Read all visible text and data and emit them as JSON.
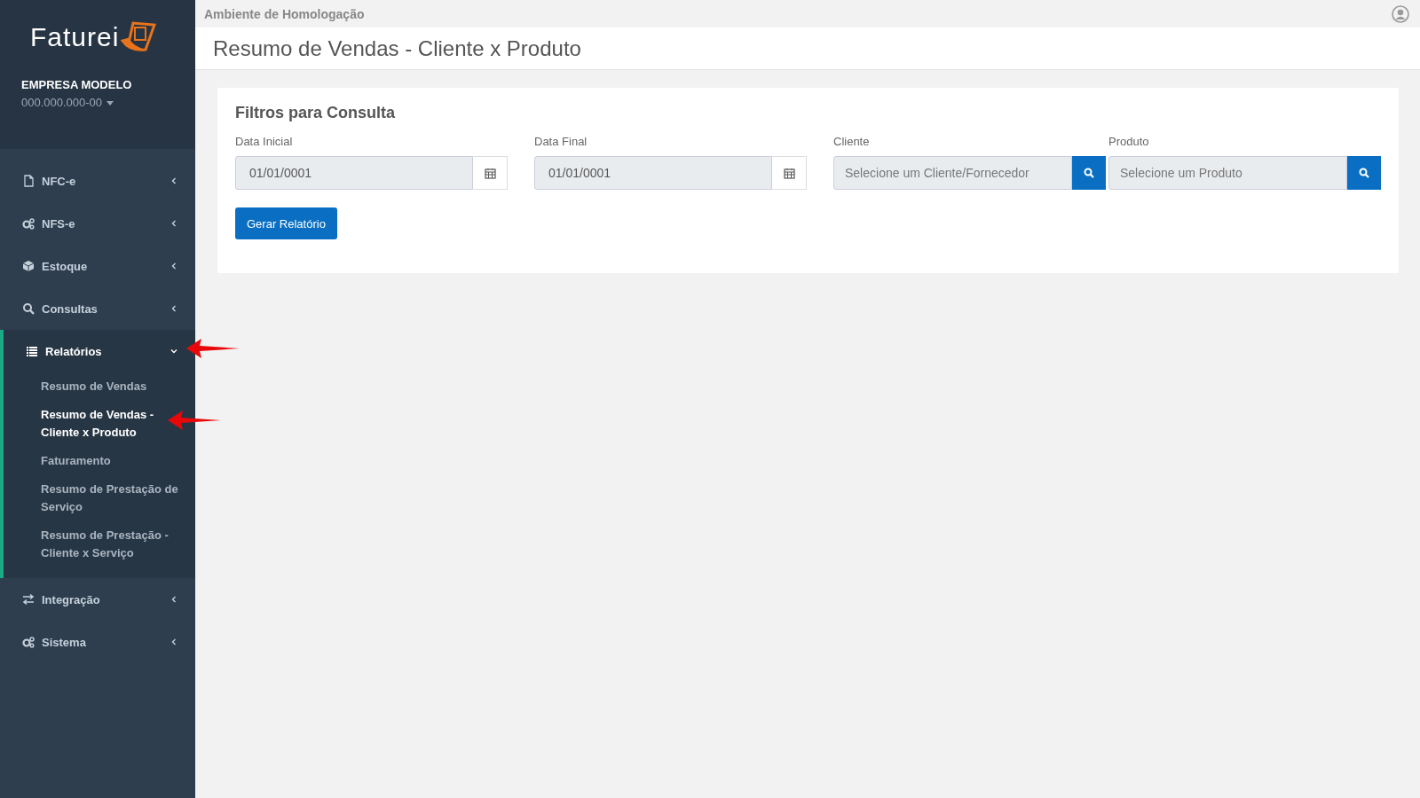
{
  "header": {
    "environment": "Ambiente de Homologação"
  },
  "brand": {
    "logo": "Faturei"
  },
  "company": {
    "name": "EMPRESA MODELO",
    "document": "000.000.000-00"
  },
  "menu": [
    {
      "label": "NFC-e",
      "expanded": false
    },
    {
      "label": "NFS-e",
      "expanded": false
    },
    {
      "label": "Estoque",
      "expanded": false
    },
    {
      "label": "Consultas",
      "expanded": false
    },
    {
      "label": "Relatórios",
      "expanded": true,
      "children": [
        {
          "label": "Resumo de Vendas",
          "selected": false
        },
        {
          "label": "Resumo de Vendas - Cliente x Produto",
          "selected": true
        },
        {
          "label": "Faturamento",
          "selected": false
        },
        {
          "label": "Resumo de Prestação de Serviço",
          "selected": false
        },
        {
          "label": "Resumo de Prestação - Cliente x Serviço",
          "selected": false
        }
      ]
    },
    {
      "label": "Integração",
      "expanded": false
    },
    {
      "label": "Sistema",
      "expanded": false
    }
  ],
  "page_title": "Resumo de Vendas - Cliente x Produto",
  "filters": {
    "title": "Filtros para Consulta",
    "fields": [
      {
        "kind": "date",
        "label": "Data Inicial",
        "value": "01/01/0001"
      },
      {
        "kind": "date",
        "label": "Data Final",
        "value": "01/01/0001"
      },
      {
        "kind": "lookup",
        "label": "Cliente",
        "placeholder": "Selecione um Cliente/Fornecedor"
      },
      {
        "kind": "lookup",
        "label": "Produto",
        "placeholder": "Selecione um Produto"
      }
    ],
    "button": "Gerar Relatório"
  }
}
